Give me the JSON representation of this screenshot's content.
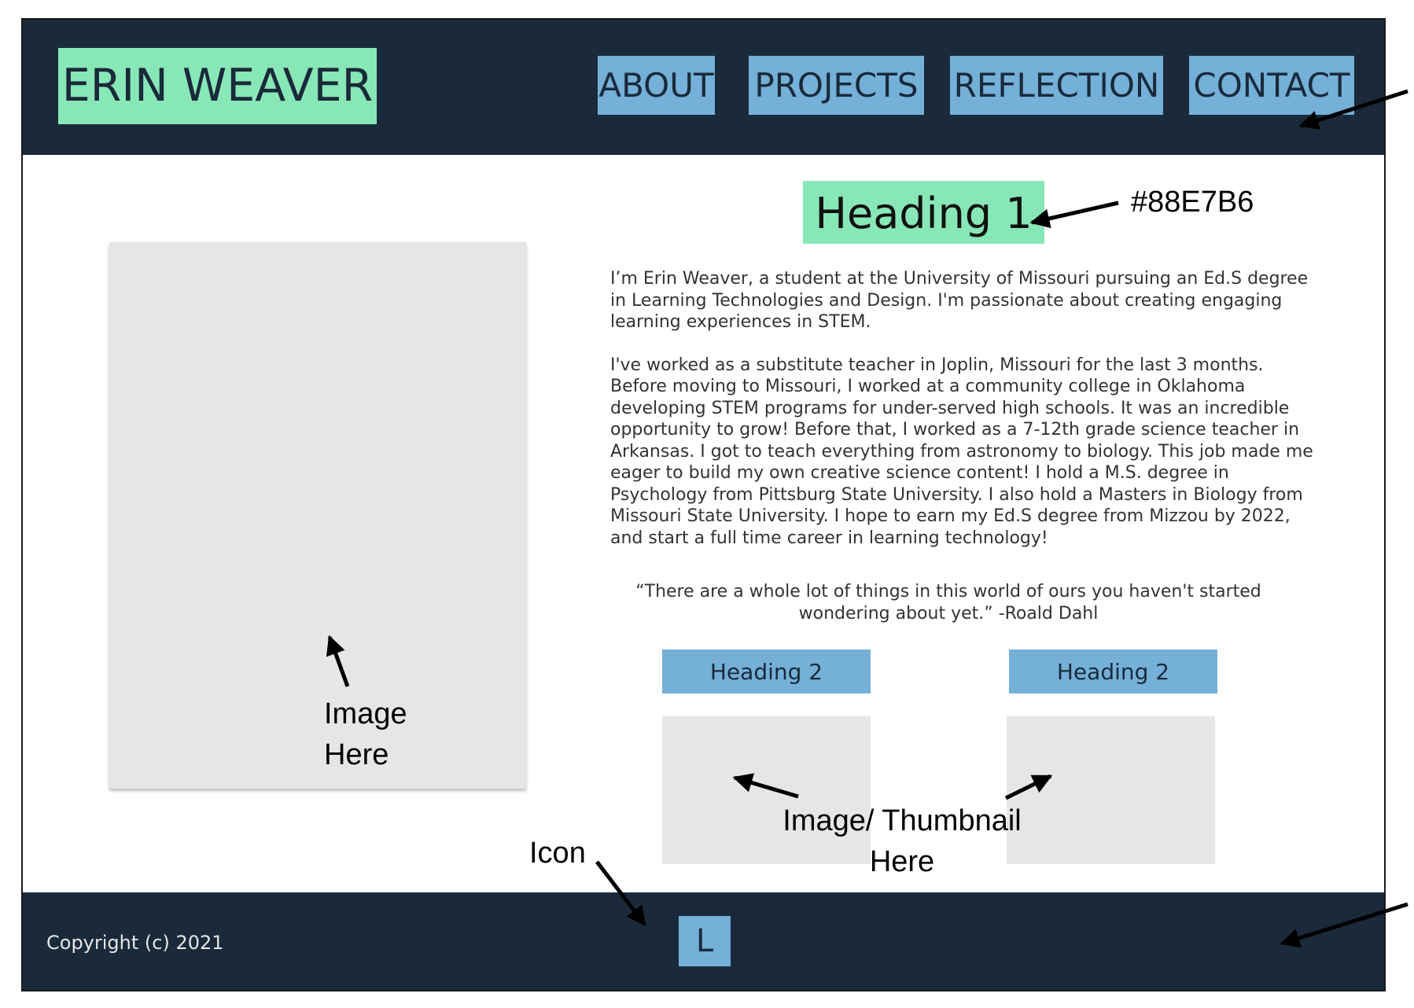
{
  "header": {
    "logo": "ERIN WEAVER",
    "nav": [
      "ABOUT",
      "PROJECTS",
      "REFLECTION",
      "CONTACT"
    ]
  },
  "main": {
    "heading1": "Heading 1",
    "bio_paragraphs": [
      "I’m Erin Weaver, a student at the University of Missouri pursuing an Ed.S degree in Learning Technologies and Design. I'm passionate about creating engaging learning experiences in STEM.",
      "I've worked as a substitute teacher in Joplin, Missouri for the last 3 months. Before moving to Missouri, I worked at a community college in Oklahoma developing STEM programs for under-served high schools. It was an incredible opportunity to grow! Before that, I worked as a 7-12th grade science teacher in Arkansas. I got to teach everything from astronomy to biology. This job made me eager to build my own creative science content! I hold a M.S. degree in Psychology from Pittsburg State University. I also hold a Masters in Biology from Missouri State University. I hope to earn my Ed.S degree from Mizzou by 2022, and start a full time career in learning technology!"
    ],
    "quote": "“There are a whole lot of things in this world of ours you haven't started wondering about yet.” -Roald Dahl",
    "sections": [
      {
        "heading": "Heading 2"
      },
      {
        "heading": "Heading 2"
      }
    ]
  },
  "footer": {
    "copyright": "Copyright (c) 2021",
    "icon_label": "L"
  },
  "annotations": {
    "color_note": "#88E7B6",
    "image_note_line1": "Image",
    "image_note_line2": "Here",
    "thumb_note_line1": "Image/ Thumbnail",
    "thumb_note_line2": "Here",
    "icon_note": "Icon"
  },
  "colors": {
    "header_bg": "#1a2a3a",
    "accent_green": "#88E7B6",
    "accent_blue": "#74b0d8",
    "placeholder_gray": "#e6e6e6"
  }
}
